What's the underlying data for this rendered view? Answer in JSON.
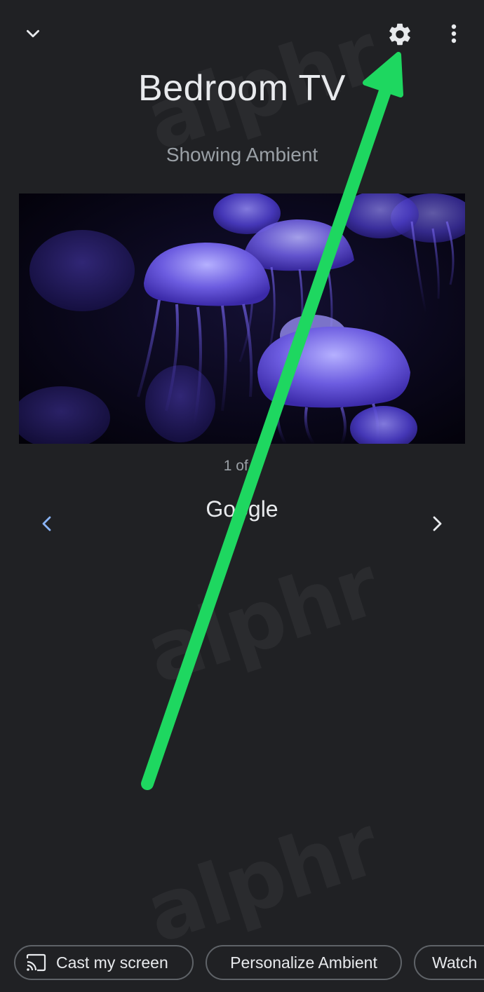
{
  "header": {
    "back_icon": "chevron-down-icon",
    "settings_icon": "gear-icon",
    "more_icon": "more-vert-icon"
  },
  "device": {
    "title": "Bedroom TV",
    "status": "Showing Ambient"
  },
  "ambient": {
    "counter": "1 of 5",
    "source": "Google",
    "prev_icon": "chevron-left-icon",
    "next_icon": "chevron-right-icon",
    "prev_color": "#8ab4f8",
    "next_color": "#e8eaed"
  },
  "watermark": "alphr",
  "chips": [
    {
      "label": "Cast my screen",
      "icon": "cast-icon"
    },
    {
      "label": "Personalize Ambient"
    },
    {
      "label": "Watch"
    }
  ],
  "annotation": {
    "arrow_color": "#1ed760"
  },
  "colors": {
    "background": "#202124",
    "text_primary": "#e8eaed",
    "text_secondary": "#9aa0a6",
    "chip_border": "#5f6368"
  }
}
